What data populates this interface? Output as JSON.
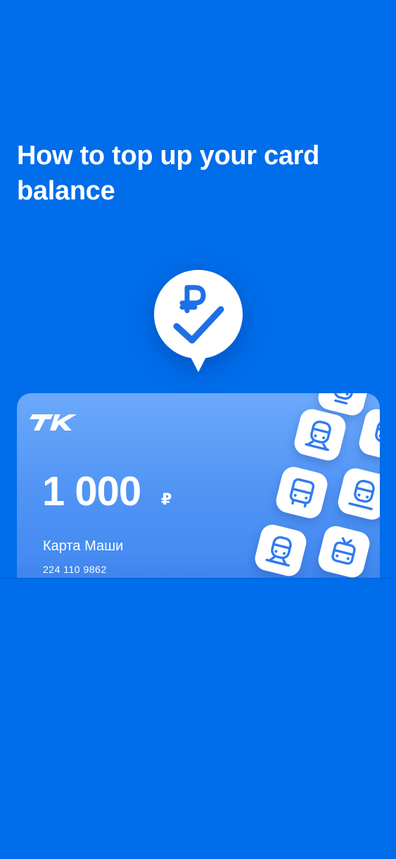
{
  "colors": {
    "background": "#006DEA",
    "card_gradient_top": "#6BA9FB",
    "card_gradient_bottom": "#3A82EE",
    "tile_icon": "#2F7BF0"
  },
  "onboarding": {
    "title": "How to top up your card balance"
  },
  "bubble": {
    "icon": "ruble-check-icon"
  },
  "card": {
    "logo": "tk-logo",
    "balance": "1 000",
    "currency": "₽",
    "name": "Карта Маши",
    "number": "224 110 9862",
    "transport_icons": [
      "tram-icon",
      "tram-icon",
      "bus-icon",
      "tram-icon",
      "tram-icon",
      "trolleybus-icon"
    ]
  }
}
